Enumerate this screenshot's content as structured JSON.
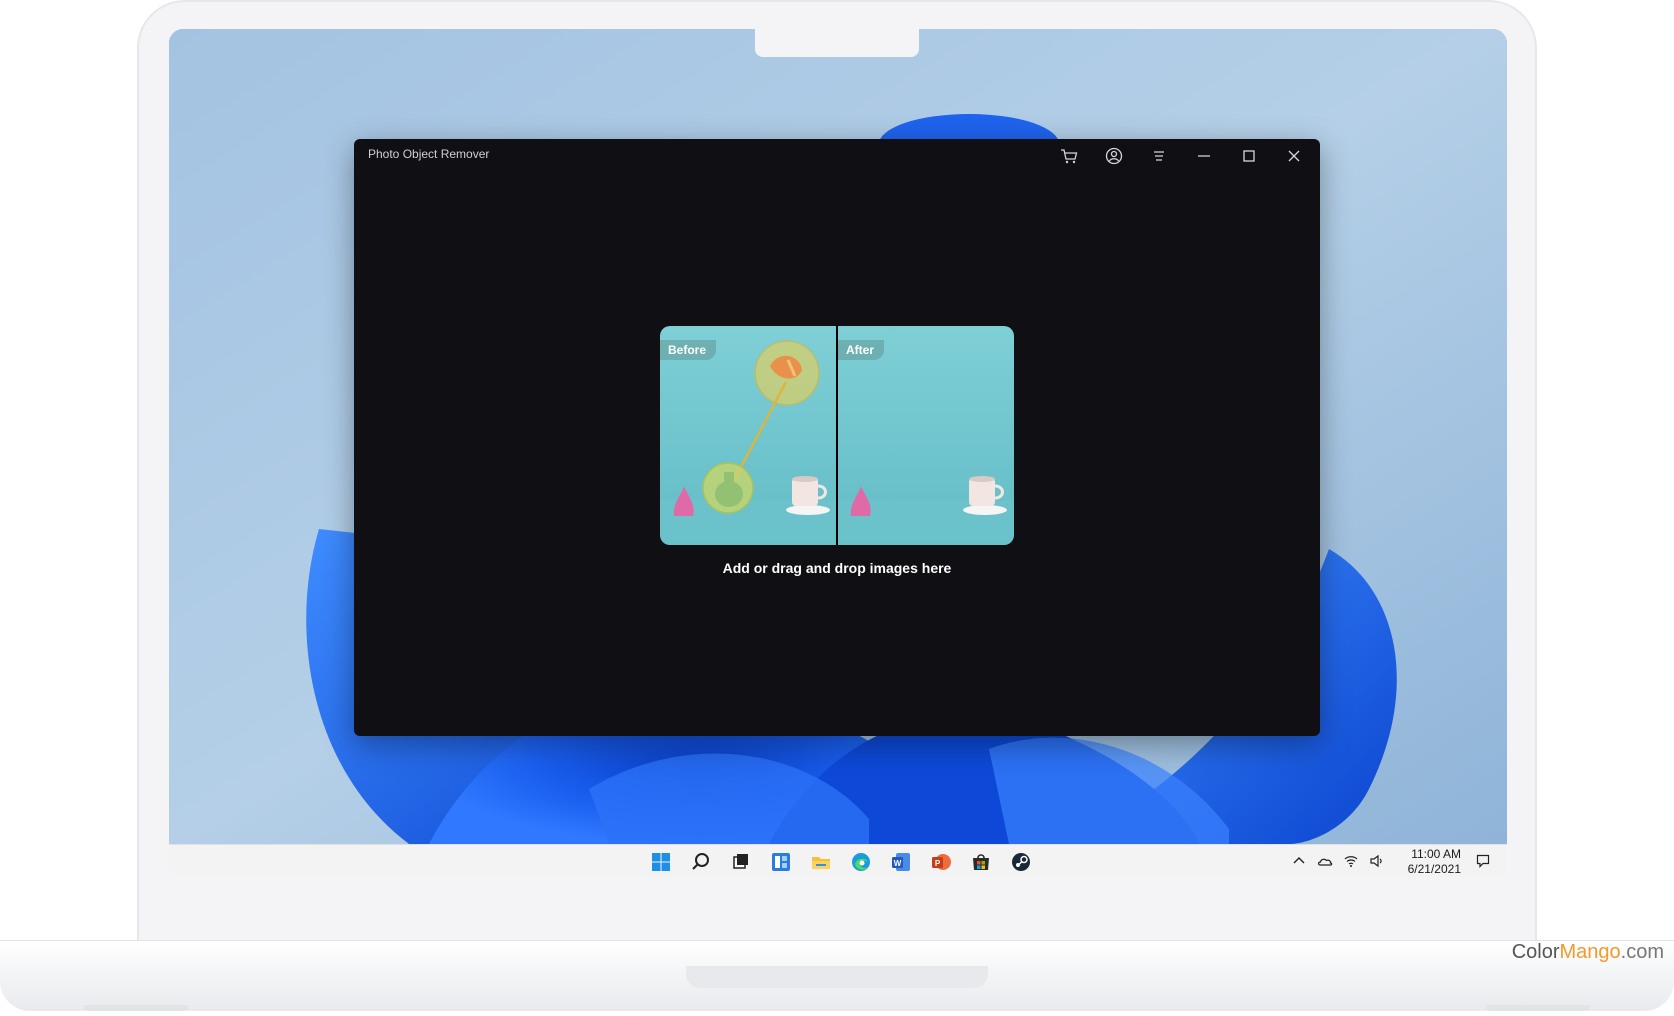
{
  "app": {
    "title": "Photo Object Remover",
    "drop_prompt": "Add or drag and drop images here",
    "before_label": "Before",
    "after_label": "After",
    "toolbar_icons": [
      "cart-icon",
      "account-icon",
      "menu-icon",
      "minimize-icon",
      "maximize-icon",
      "close-icon"
    ]
  },
  "taskbar": {
    "icons": [
      "windows-start-icon",
      "search-icon",
      "task-view-icon",
      "widgets-icon",
      "file-explorer-icon",
      "edge-icon",
      "word-icon",
      "powerpoint-icon",
      "store-icon",
      "steam-icon"
    ],
    "tray_icons": [
      "chevron-up-icon",
      "onedrive-icon",
      "wifi-icon",
      "volume-icon",
      "notification-icon"
    ],
    "time": "11:00 AM",
    "date": "6/21/2021"
  },
  "watermark": {
    "part1": "Color",
    "part2": "Mango",
    "part3": ".com"
  },
  "colors": {
    "app_background": "#0f0f14",
    "wallpaper_blue": "#1b5ee6",
    "accent_orange": "#f29a2e"
  }
}
